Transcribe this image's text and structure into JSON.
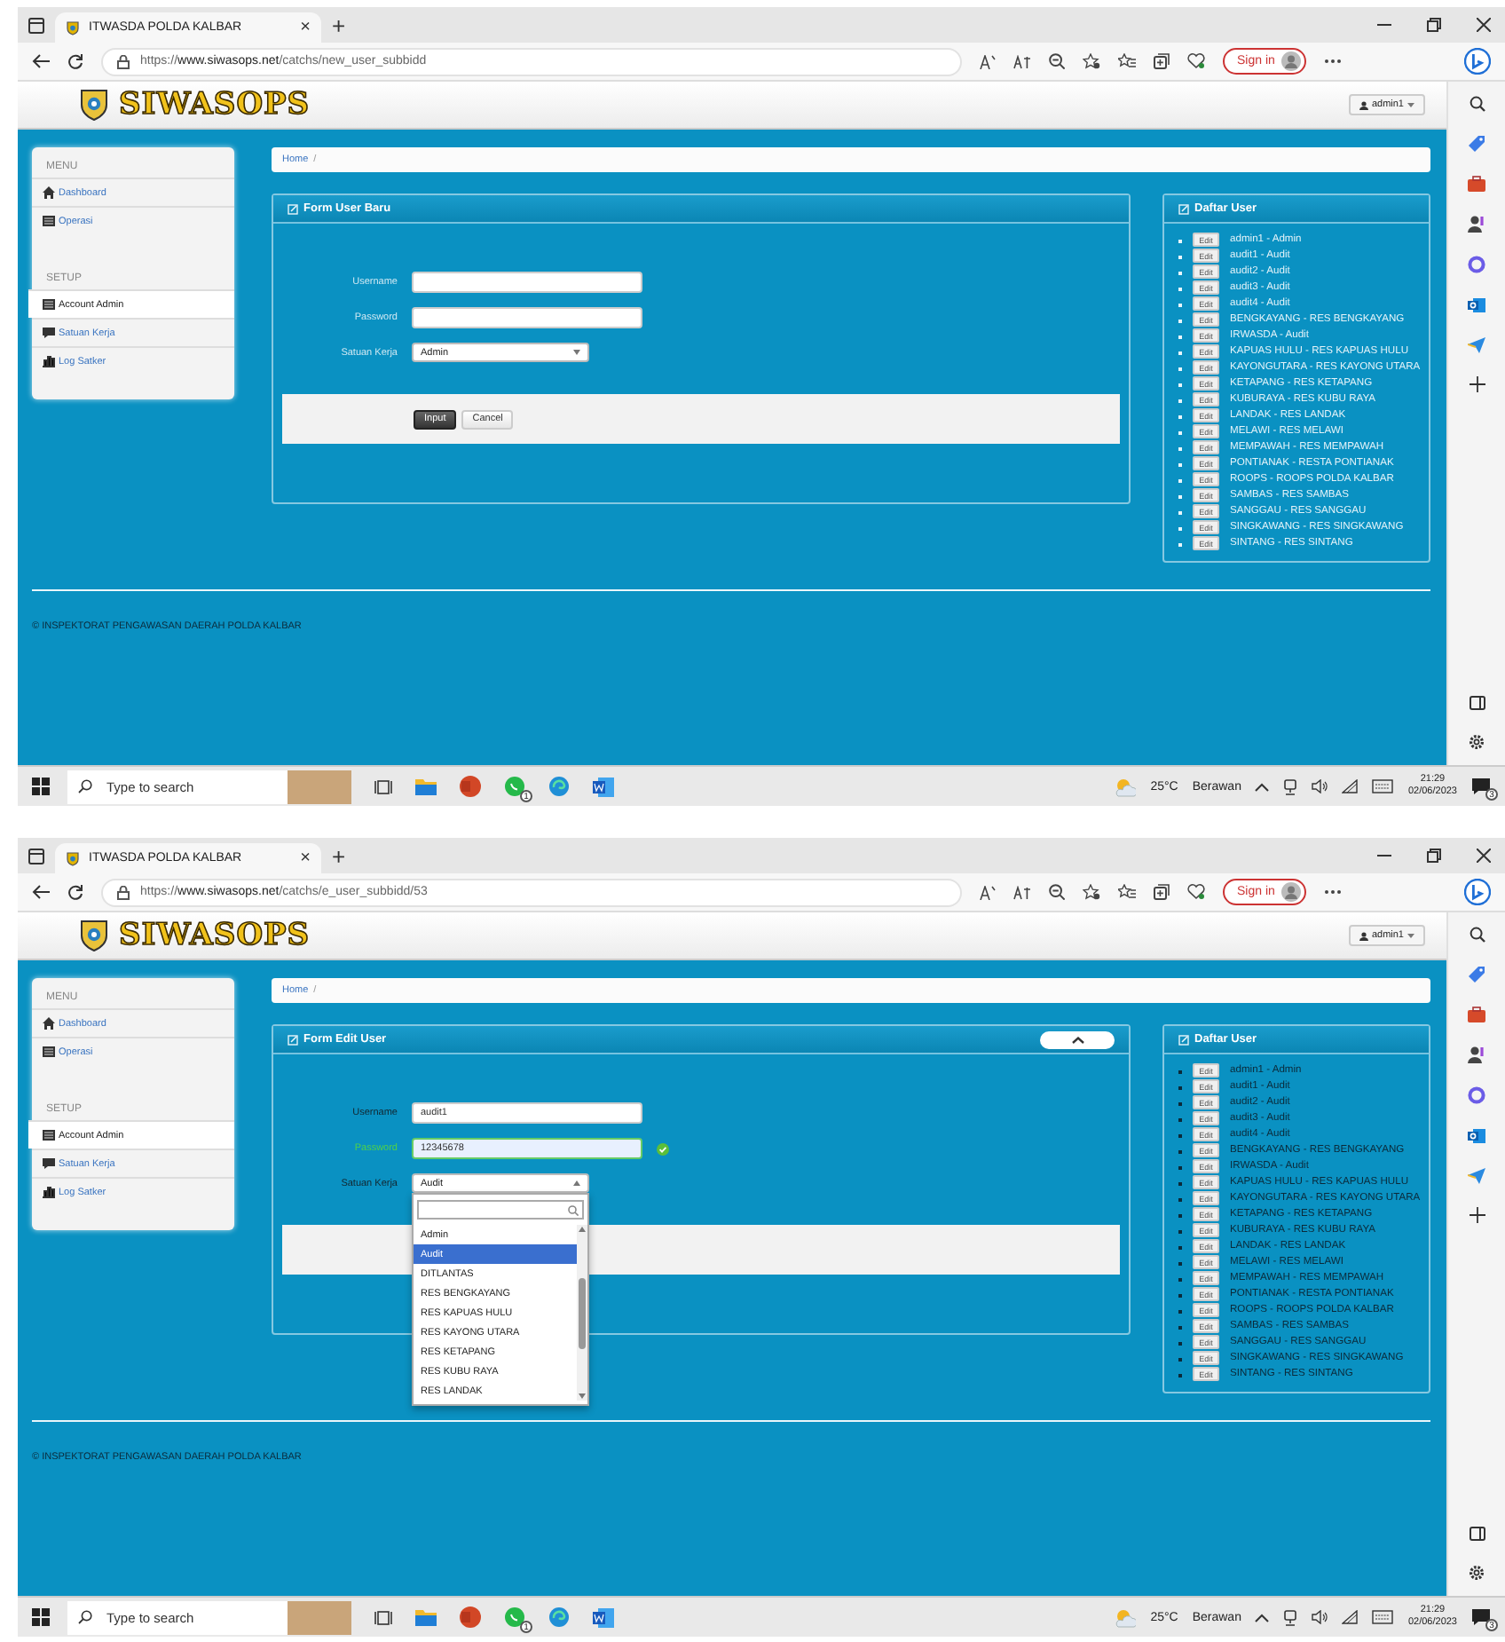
{
  "screens": [
    {
      "browser": {
        "tab_title": "ITWASDA POLDA KALBAR",
        "close": "×",
        "new_tab": "+",
        "url_scheme": "https://",
        "url_host": "www.siwasops.net",
        "url_path": "/catchs/new_user_subbidd",
        "sign_in": "Sign in"
      },
      "header": {
        "brand": "SIWASOPS",
        "user_menu": "admin1"
      },
      "breadcrumb": {
        "items": [
          "Home"
        ],
        "separator": "/"
      },
      "sidebar": {
        "sections": [
          {
            "title": "MENU",
            "items": [
              {
                "label": "Dashboard",
                "selected": false
              },
              {
                "label": "Operasi",
                "selected": false
              }
            ]
          },
          {
            "title": "SETUP",
            "items": [
              {
                "label": "Account Admin",
                "selected": true
              },
              {
                "label": "Satuan Kerja",
                "selected": false
              },
              {
                "label": "Log Satker",
                "selected": false
              }
            ]
          }
        ]
      },
      "form": {
        "title": "Form User Baru",
        "collapse_button": false,
        "fields": [
          {
            "kind": "text",
            "label": "Username",
            "valid": false
          },
          {
            "kind": "text",
            "label": "Password",
            "valid": false
          },
          {
            "kind": "select",
            "label": "Satuan Kerja",
            "value": "Admin",
            "open": false
          }
        ],
        "buttons": [
          {
            "label": "Input",
            "kind": "primary"
          },
          {
            "label": "Cancel",
            "kind": "default"
          }
        ]
      },
      "user_list": {
        "title": "Daftar User",
        "items": [
          {
            "button": "Edit",
            "text": "admin1 - Admin"
          },
          {
            "button": "Edit",
            "text": "audit1 - Audit"
          },
          {
            "button": "Edit",
            "text": "audit2 - Audit"
          },
          {
            "button": "Edit",
            "text": "audit3 - Audit"
          },
          {
            "button": "Edit",
            "text": "audit4 - Audit"
          },
          {
            "button": "Edit",
            "text": "BENGKAYANG - RES BENGKAYANG"
          },
          {
            "button": "Edit",
            "text": "IRWASDA - Audit"
          },
          {
            "button": "Edit",
            "text": "KAPUAS HULU - RES KAPUAS HULU"
          },
          {
            "button": "Edit",
            "text": "KAYONGUTARA - RES KAYONG UTARA"
          },
          {
            "button": "Edit",
            "text": "KETAPANG - RES KETAPANG"
          },
          {
            "button": "Edit",
            "text": "KUBURAYA - RES KUBU RAYA"
          },
          {
            "button": "Edit",
            "text": "LANDAK - RES LANDAK"
          },
          {
            "button": "Edit",
            "text": "MELAWI - RES MELAWI"
          },
          {
            "button": "Edit",
            "text": "MEMPAWAH - RES MEMPAWAH"
          },
          {
            "button": "Edit",
            "text": "PONTIANAK - RESTA PONTIANAK"
          },
          {
            "button": "Edit",
            "text": "ROOPS - ROOPS POLDA KALBAR"
          },
          {
            "button": "Edit",
            "text": "SAMBAS - RES SAMBAS"
          },
          {
            "button": "Edit",
            "text": "SANGGAU - RES SANGGAU"
          },
          {
            "button": "Edit",
            "text": "SINGKAWANG - RES SINGKAWANG"
          },
          {
            "button": "Edit",
            "text": "SINTANG - RES SINTANG"
          }
        ]
      },
      "footer": "© INSPEKTORAT PENGAWASAN DAERAH POLDA KALBAR",
      "taskbar": {
        "search_placeholder": "Type to search",
        "whatsapp_badge": "1",
        "temperature": "25°C",
        "weather": "Berawan",
        "time": "21:29",
        "date": "02/06/2023",
        "notification_badge": "3"
      }
    },
    {
      "browser": {
        "tab_title": "ITWASDA POLDA KALBAR",
        "close": "×",
        "new_tab": "+",
        "url_scheme": "https://",
        "url_host": "www.siwasops.net",
        "url_path": "/catchs/e_user_subbidd/53",
        "sign_in": "Sign in"
      },
      "header": {
        "brand": "SIWASOPS",
        "user_menu": "admin1"
      },
      "breadcrumb": {
        "items": [
          "Home"
        ],
        "separator": "/"
      },
      "sidebar": {
        "sections": [
          {
            "title": "MENU",
            "items": [
              {
                "label": "Dashboard",
                "selected": false
              },
              {
                "label": "Operasi",
                "selected": false
              }
            ]
          },
          {
            "title": "SETUP",
            "items": [
              {
                "label": "Account Admin",
                "selected": true
              },
              {
                "label": "Satuan Kerja",
                "selected": false
              },
              {
                "label": "Log Satker",
                "selected": false
              }
            ]
          }
        ]
      },
      "form": {
        "title": "Form Edit User",
        "collapse_button": true,
        "fields": [
          {
            "kind": "text",
            "label": "Username",
            "value": "audit1",
            "valid": false
          },
          {
            "kind": "text",
            "label": "Password",
            "value": "12345678",
            "valid": true
          },
          {
            "kind": "select",
            "label": "Satuan Kerja",
            "value": "Audit",
            "open": true,
            "options": [
              {
                "label": "Admin",
                "selected": false
              },
              {
                "label": "Audit",
                "selected": true
              },
              {
                "label": "DITLANTAS",
                "selected": false
              },
              {
                "label": "RES BENGKAYANG",
                "selected": false
              },
              {
                "label": "RES KAPUAS HULU",
                "selected": false
              },
              {
                "label": "RES KAYONG UTARA",
                "selected": false
              },
              {
                "label": "RES KETAPANG",
                "selected": false
              },
              {
                "label": "RES KUBU RAYA",
                "selected": false
              },
              {
                "label": "RES LANDAK",
                "selected": false
              }
            ]
          }
        ]
      },
      "user_list": {
        "title": "Daftar User",
        "items": [
          {
            "button": "Edit",
            "text": "admin1 - Admin"
          },
          {
            "button": "Edit",
            "text": "audit1 - Audit"
          },
          {
            "button": "Edit",
            "text": "audit2 - Audit"
          },
          {
            "button": "Edit",
            "text": "audit3 - Audit"
          },
          {
            "button": "Edit",
            "text": "audit4 - Audit"
          },
          {
            "button": "Edit",
            "text": "BENGKAYANG - RES BENGKAYANG"
          },
          {
            "button": "Edit",
            "text": "IRWASDA - Audit"
          },
          {
            "button": "Edit",
            "text": "KAPUAS HULU - RES KAPUAS HULU"
          },
          {
            "button": "Edit",
            "text": "KAYONGUTARA - RES KAYONG UTARA"
          },
          {
            "button": "Edit",
            "text": "KETAPANG - RES KETAPANG"
          },
          {
            "button": "Edit",
            "text": "KUBURAYA - RES KUBU RAYA"
          },
          {
            "button": "Edit",
            "text": "LANDAK - RES LANDAK"
          },
          {
            "button": "Edit",
            "text": "MELAWI - RES MELAWI"
          },
          {
            "button": "Edit",
            "text": "MEMPAWAH - RES MEMPAWAH"
          },
          {
            "button": "Edit",
            "text": "PONTIANAK - RESTA PONTIANAK"
          },
          {
            "button": "Edit",
            "text": "ROOPS - ROOPS POLDA KALBAR"
          },
          {
            "button": "Edit",
            "text": "SAMBAS - RES SAMBAS"
          },
          {
            "button": "Edit",
            "text": "SANGGAU - RES SANGGAU"
          },
          {
            "button": "Edit",
            "text": "SINGKAWANG - RES SINGKAWANG"
          },
          {
            "button": "Edit",
            "text": "SINTANG - RES SINTANG"
          }
        ]
      },
      "footer": "© INSPEKTORAT PENGAWASAN DAERAH POLDA KALBAR",
      "taskbar": {
        "search_placeholder": "Type to search",
        "whatsapp_badge": "1",
        "temperature": "25°C",
        "weather": "Berawan",
        "time": "21:29",
        "date": "02/06/2023",
        "notification_badge": "3"
      }
    }
  ]
}
